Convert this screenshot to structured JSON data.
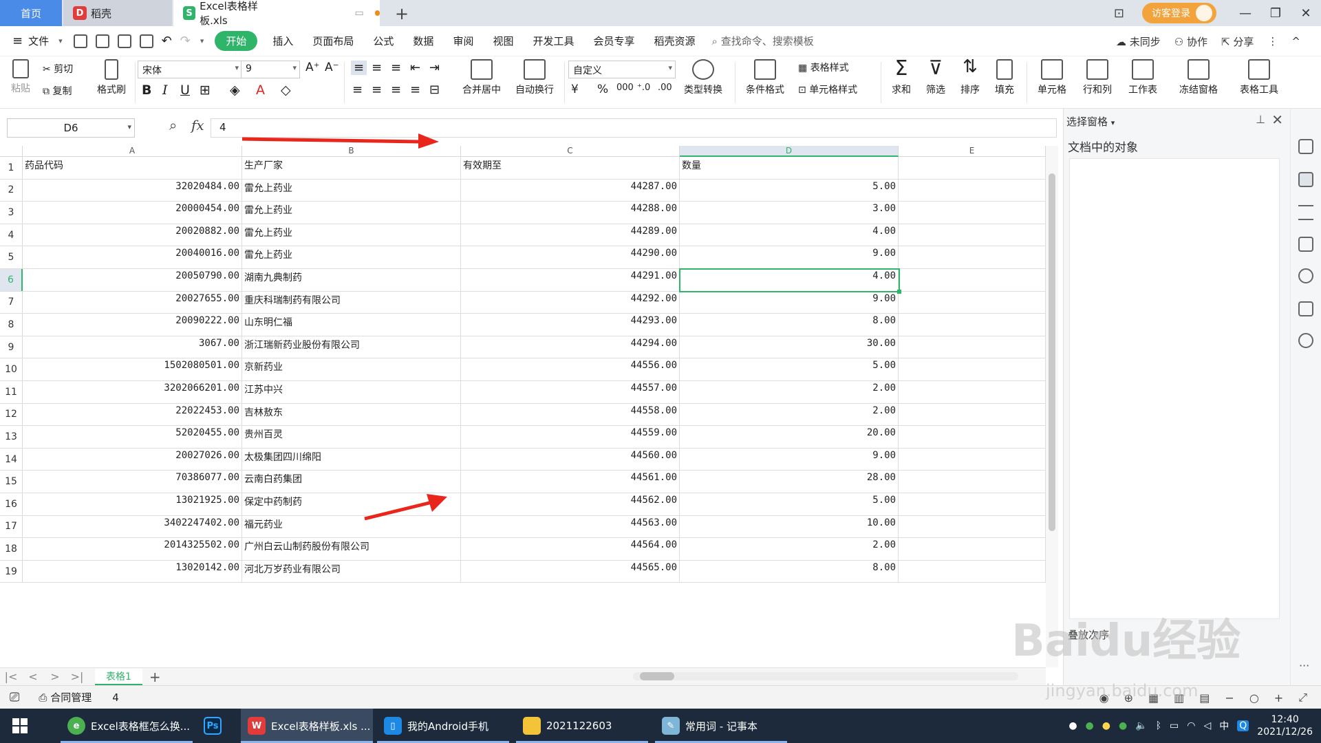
{
  "titlebar": {
    "tabs": [
      {
        "label": "首页"
      },
      {
        "label": "稻壳"
      },
      {
        "label": "Excel表格样板.xls"
      }
    ],
    "login_label": "访客登录",
    "brand_colors": {
      "home_tab": "#4a8be8",
      "accent_green": "#2fb56a",
      "login": "#f3a33c"
    }
  },
  "menubar": {
    "file_label": "文件",
    "items": [
      "开始",
      "插入",
      "页面布局",
      "公式",
      "数据",
      "审阅",
      "视图",
      "开发工具",
      "会员专享",
      "稻壳资源"
    ],
    "search_placeholder": "查找命令、搜索模板",
    "sync_label": "未同步",
    "collab_label": "协作",
    "share_label": "分享"
  },
  "ribbon": {
    "paste": "粘贴",
    "cut": "剪切",
    "copy": "复制",
    "format_painter": "格式刷",
    "font_name": "宋体",
    "font_size": "9",
    "bold": "B",
    "italic": "I",
    "underline": "U",
    "merge_center": "合并居中",
    "wrap_text": "自动换行",
    "number_format": "自定义",
    "currency": "¥",
    "percent": "%",
    "thousands": "000",
    "type_convert": "类型转换",
    "cond_format": "条件格式",
    "table_style": "表格样式",
    "cell_style": "单元格样式",
    "sum": "求和",
    "filter": "筛选",
    "sort": "排序",
    "fill": "填充",
    "cell": "单元格",
    "row_col": "行和列",
    "worksheet": "工作表",
    "freeze": "冻结窗格",
    "table_tools": "表格工具"
  },
  "formula_bar": {
    "name_box": "D6",
    "fx": "fx",
    "value": "4"
  },
  "sheet": {
    "columns": [
      "A",
      "B",
      "C",
      "D",
      "E"
    ],
    "active_column": "D",
    "active_row": "6",
    "rows": [
      {
        "n": "1",
        "a": "药品代码",
        "b": "生产厂家",
        "c": "有效期至",
        "d": "数量"
      },
      {
        "n": "2",
        "a": "32020484.00",
        "b": "雷允上药业",
        "c": "44287.00",
        "d": "5.00"
      },
      {
        "n": "3",
        "a": "20000454.00",
        "b": "雷允上药业",
        "c": "44288.00",
        "d": "3.00"
      },
      {
        "n": "4",
        "a": "20020882.00",
        "b": "雷允上药业",
        "c": "44289.00",
        "d": "4.00"
      },
      {
        "n": "5",
        "a": "20040016.00",
        "b": "雷允上药业",
        "c": "44290.00",
        "d": "9.00"
      },
      {
        "n": "6",
        "a": "20050790.00",
        "b": "湖南九典制药",
        "c": "44291.00",
        "d": "4.00"
      },
      {
        "n": "7",
        "a": "20027655.00",
        "b": "重庆科瑞制药有限公司",
        "c": "44292.00",
        "d": "9.00"
      },
      {
        "n": "8",
        "a": "20090222.00",
        "b": "山东明仁福",
        "c": "44293.00",
        "d": "8.00"
      },
      {
        "n": "9",
        "a": "3067.00",
        "b": "浙江瑞新药业股份有限公司",
        "c": "44294.00",
        "d": "30.00"
      },
      {
        "n": "10",
        "a": "1502080501.00",
        "b": "京新药业",
        "c": "44556.00",
        "d": "5.00"
      },
      {
        "n": "11",
        "a": "3202066201.00",
        "b": "江苏中兴",
        "c": "44557.00",
        "d": "2.00"
      },
      {
        "n": "12",
        "a": "22022453.00",
        "b": "吉林敖东",
        "c": "44558.00",
        "d": "2.00"
      },
      {
        "n": "13",
        "a": "52020455.00",
        "b": "贵州百灵",
        "c": "44559.00",
        "d": "20.00"
      },
      {
        "n": "14",
        "a": "20027026.00",
        "b": "太极集团四川绵阳",
        "c": "44560.00",
        "d": "9.00"
      },
      {
        "n": "15",
        "a": "70386077.00",
        "b": "云南白药集团",
        "c": "44561.00",
        "d": "28.00"
      },
      {
        "n": "16",
        "a": "13021925.00",
        "b": "保定中药制药",
        "c": "44562.00",
        "d": "5.00"
      },
      {
        "n": "17",
        "a": "3402247402.00",
        "b": "福元药业",
        "c": "44563.00",
        "d": "10.00"
      },
      {
        "n": "18",
        "a": "2014325502.00",
        "b": "广州白云山制药股份有限公司",
        "c": "44564.00",
        "d": "2.00"
      },
      {
        "n": "19",
        "a": "13020142.00",
        "b": "河北万岁药业有限公司",
        "c": "44565.00",
        "d": "8.00"
      }
    ]
  },
  "sheet_tabs": {
    "active": "表格1"
  },
  "status_bar": {
    "doc_manage": "合同管理",
    "value": "4"
  },
  "right_pane": {
    "title": "选择窗格",
    "subtitle": "文档中的对象",
    "order_label": "叠放次序"
  },
  "taskbar": {
    "items": [
      {
        "label": "Excel表格框怎么换..."
      },
      {
        "label": "Ps"
      },
      {
        "label": "Excel表格样板.xls ..."
      },
      {
        "label": "我的Android手机"
      },
      {
        "label": "2021122603"
      },
      {
        "label": "常用词 - 记事本"
      }
    ],
    "ime": "中",
    "time": "12:40",
    "date": "2021/12/26"
  },
  "watermark": {
    "text": "Baidu经验",
    "url": "jingyan.baidu.com"
  }
}
